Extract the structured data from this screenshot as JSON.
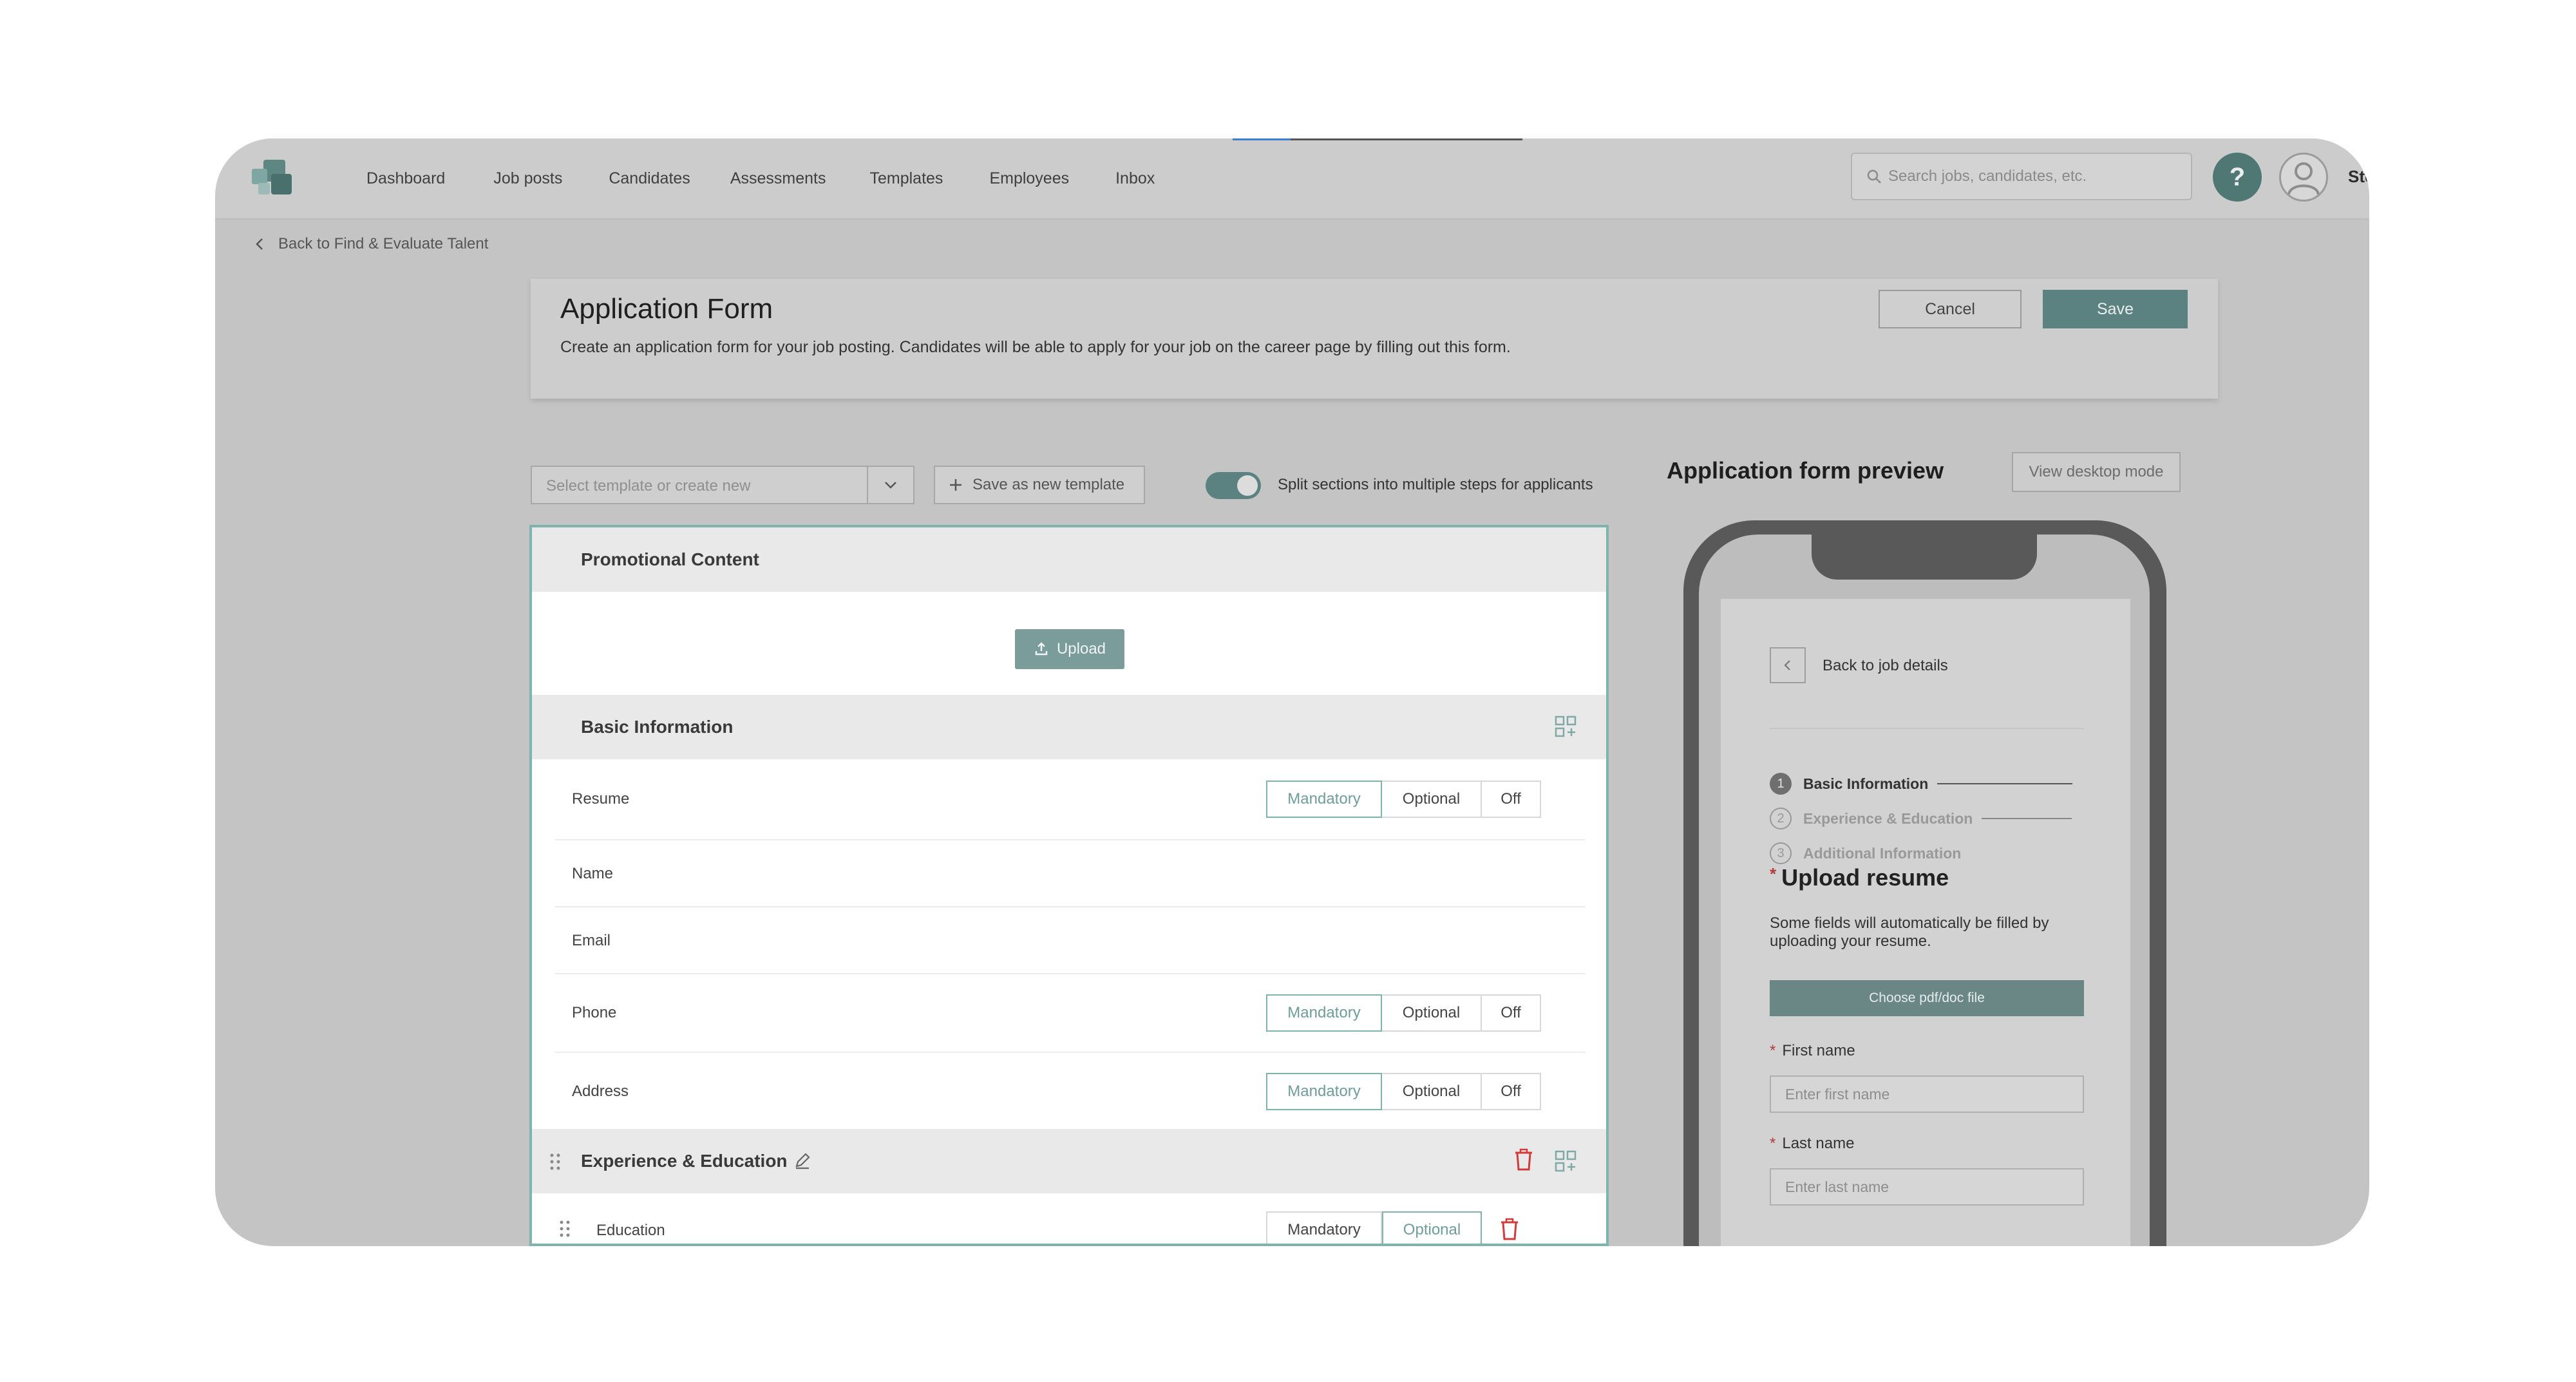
{
  "nav": {
    "links": [
      "Dashboard",
      "Job posts",
      "Candidates",
      "Assessments",
      "Templates",
      "Employees",
      "Inbox"
    ],
    "search_placeholder": "Search jobs, candidates, etc.",
    "help_label": "?",
    "username": "Ste"
  },
  "back_link": "Back to Find & Evaluate Talent",
  "header": {
    "title": "Application Form",
    "description": "Create an application form for your job posting. Candidates will be able to apply for your job on the career page by filling out this form.",
    "cancel_label": "Cancel",
    "save_label": "Save"
  },
  "toolbar": {
    "template_placeholder": "Select template or create new",
    "save_template_label": "Save as new template",
    "split_toggle_label": "Split sections into multiple steps for applicants",
    "split_toggle_on": true
  },
  "builder": {
    "promo_title": "Promotional Content",
    "upload_label": "Upload",
    "basic_title": "Basic Information",
    "experience_title": "Experience & Education",
    "options": {
      "mandatory": "Mandatory",
      "optional": "Optional",
      "off": "Off"
    },
    "basic_fields": [
      {
        "label": "Resume",
        "state": "Mandatory"
      },
      {
        "label": "Name"
      },
      {
        "label": "Email"
      },
      {
        "label": "Phone",
        "state": "Mandatory"
      },
      {
        "label": "Address",
        "state": "Mandatory"
      }
    ],
    "experience_fields": [
      {
        "label": "Education",
        "state": "Optional"
      }
    ]
  },
  "preview": {
    "title": "Application form preview",
    "view_desktop_label": "View desktop mode",
    "back_label": "Back to job details",
    "steps": [
      {
        "num": "1",
        "name": "Basic Information"
      },
      {
        "num": "2",
        "name": "Experience & Education"
      },
      {
        "num": "3",
        "name": "Additional Information"
      }
    ],
    "upload_heading": "Upload resume",
    "upload_desc": "Some fields will automatically be filled by uploading your resume.",
    "choose_file_label": "Choose pdf/doc file",
    "first_name_label": "First name",
    "first_name_placeholder": "Enter first name",
    "last_name_label": "Last name",
    "last_name_placeholder": "Enter last name"
  },
  "colors": {
    "accent": "#5b8281",
    "selected_outline": "#7fb3ad",
    "danger": "#d23b3b"
  }
}
